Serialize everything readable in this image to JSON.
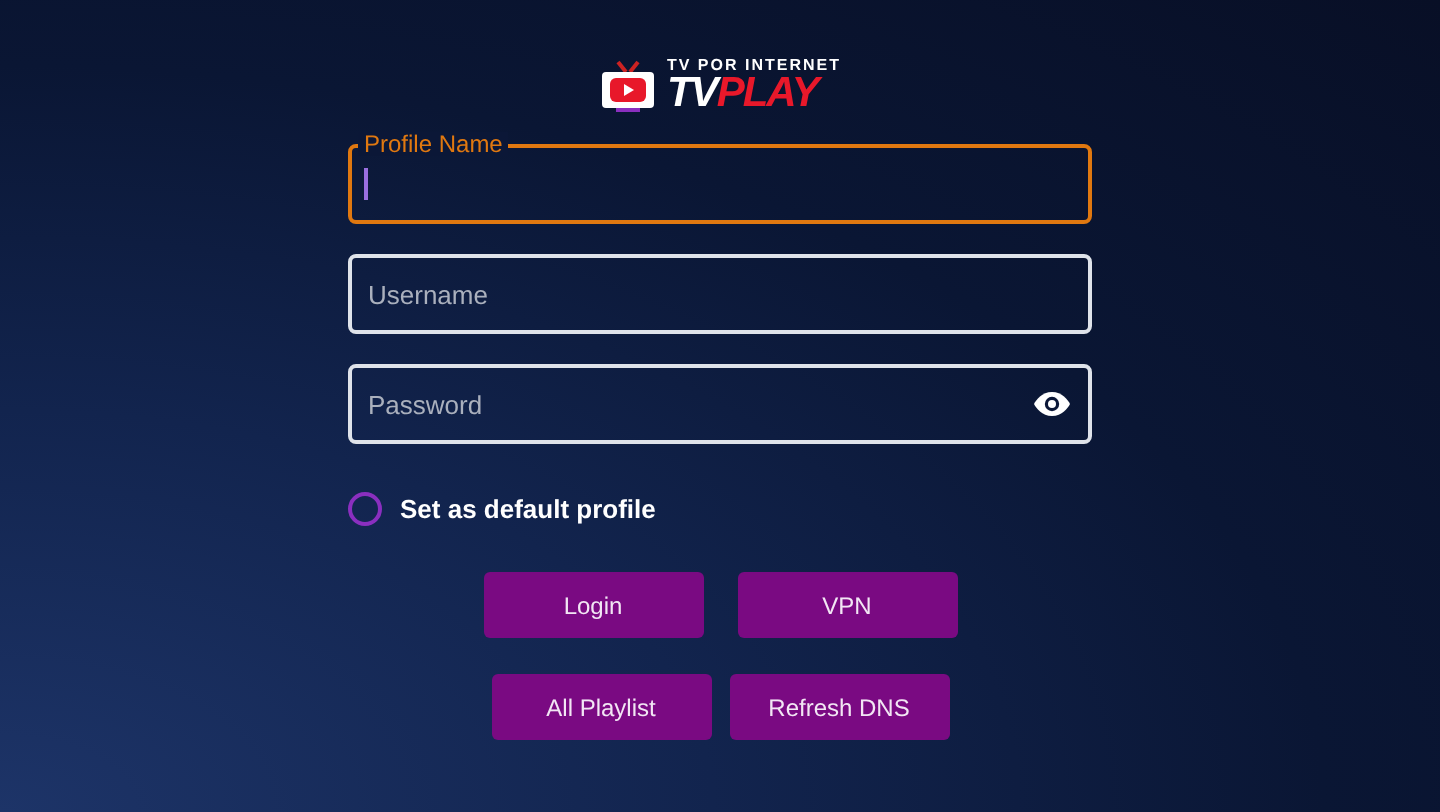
{
  "logo": {
    "tagline": "TV POR INTERNET",
    "name_first": "TV",
    "name_second": "PLAY"
  },
  "fields": [
    {
      "kind": "text",
      "label": "Profile Name",
      "focused": true
    },
    {
      "kind": "text",
      "placeholder": "Username",
      "focused": false
    },
    {
      "kind": "password",
      "placeholder": "Password",
      "focused": false
    }
  ],
  "default_profile": {
    "label": "Set as default profile",
    "checked": false
  },
  "button_rows": [
    [
      "Login",
      "VPN"
    ],
    [
      "All Playlist",
      "Refresh DNS"
    ]
  ]
}
